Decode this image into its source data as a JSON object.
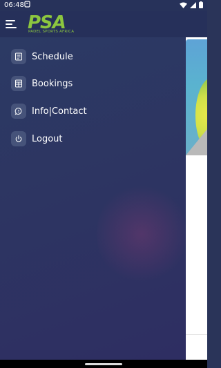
{
  "status_bar": {
    "time": "06:48"
  },
  "app": {
    "logo_text": "PSA",
    "logo_subtitle": "PADEL SPORTS AFRICA",
    "colors": {
      "brand_green": "#8cc63f",
      "header_bg": "#26305a",
      "drawer_bg": "#2d3562",
      "icon_bg": "#46537a"
    }
  },
  "menu": {
    "items": [
      {
        "label": "Schedule",
        "icon": "schedule-icon"
      },
      {
        "label": "Bookings",
        "icon": "bookings-icon"
      },
      {
        "label": "Info|Contact",
        "icon": "chat-icon"
      },
      {
        "label": "Logout",
        "icon": "power-icon"
      }
    ]
  }
}
